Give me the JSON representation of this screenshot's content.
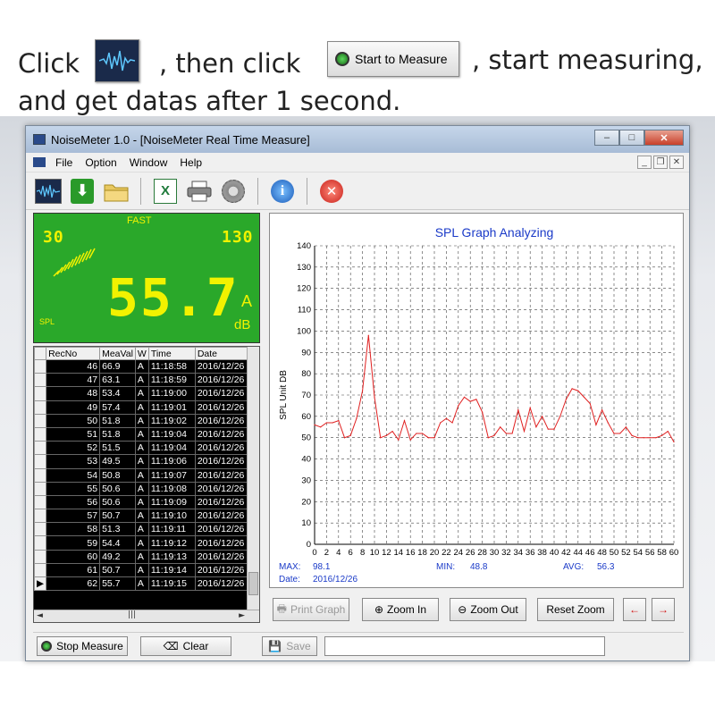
{
  "instructions": {
    "line1_a": "Click",
    "line1_b": ", then click",
    "line1_c": ", start measuring,",
    "line2": "and get datas after 1 second.",
    "button_label": "Start to Measure"
  },
  "window": {
    "title": "NoiseMeter 1.0  - [NoiseMeter Real Time Measure]",
    "controls": [
      "minimize",
      "maximize",
      "close"
    ]
  },
  "menu": {
    "items": [
      "File",
      "Option",
      "Window",
      "Help"
    ]
  },
  "toolbar": {
    "icons": [
      "realtime-measure-icon",
      "download-icon",
      "open-folder-icon",
      "excel-export-icon",
      "print-icon",
      "settings-icon",
      "info-icon",
      "exit-icon"
    ]
  },
  "lcd": {
    "mode": "FAST",
    "range_low": "30",
    "range_high": "130",
    "value": "55.7",
    "weighting": "A",
    "unit": "dB",
    "label": "SPL",
    "bg_color": "#2aa82a",
    "fg_color": "#f2f200"
  },
  "table": {
    "headers": [
      "RecNo",
      "MeaVal",
      "W",
      "Time",
      "Date"
    ],
    "rows": [
      [
        "46",
        "66.9",
        "A",
        "11:18:58",
        "2016/12/26"
      ],
      [
        "47",
        "63.1",
        "A",
        "11:18:59",
        "2016/12/26"
      ],
      [
        "48",
        "53.4",
        "A",
        "11:19:00",
        "2016/12/26"
      ],
      [
        "49",
        "57.4",
        "A",
        "11:19:01",
        "2016/12/26"
      ],
      [
        "50",
        "51.8",
        "A",
        "11:19:02",
        "2016/12/26"
      ],
      [
        "51",
        "51.8",
        "A",
        "11:19:04",
        "2016/12/26"
      ],
      [
        "52",
        "51.5",
        "A",
        "11:19:04",
        "2016/12/26"
      ],
      [
        "53",
        "49.5",
        "A",
        "11:19:06",
        "2016/12/26"
      ],
      [
        "54",
        "50.8",
        "A",
        "11:19:07",
        "2016/12/26"
      ],
      [
        "55",
        "50.6",
        "A",
        "11:19:08",
        "2016/12/26"
      ],
      [
        "56",
        "50.6",
        "A",
        "11:19:09",
        "2016/12/26"
      ],
      [
        "57",
        "50.7",
        "A",
        "11:19:10",
        "2016/12/26"
      ],
      [
        "58",
        "51.3",
        "A",
        "11:19:11",
        "2016/12/26"
      ],
      [
        "59",
        "54.4",
        "A",
        "11:19:12",
        "2016/12/26"
      ],
      [
        "60",
        "49.2",
        "A",
        "11:19:13",
        "2016/12/26"
      ],
      [
        "61",
        "50.7",
        "A",
        "11:19:14",
        "2016/12/26"
      ],
      [
        "62",
        "55.7",
        "A",
        "11:19:15",
        "2016/12/26"
      ]
    ],
    "current_row_index": 16
  },
  "graph": {
    "title": "SPL Graph Analyzing",
    "ylabel": "SPL  Unit  DB",
    "stats": {
      "max_label": "MAX:",
      "max_value": "98.1",
      "min_label": "MIN:",
      "min_value": "48.8",
      "avg_label": "AVG:",
      "avg_value": "56.3",
      "date_label": "Date:",
      "date_value": "2016/12/26"
    },
    "buttons": {
      "print": "Print Graph",
      "zoom_in": "Zoom In",
      "zoom_out": "Zoom Out",
      "reset": "Reset Zoom"
    }
  },
  "bottom": {
    "stop": "Stop Measure",
    "clear": "Clear",
    "save": "Save",
    "status_text": ""
  },
  "chart_data": {
    "type": "line",
    "title": "SPL Graph Analyzing",
    "xlabel": "",
    "ylabel": "SPL  Unit  DB",
    "xlim": [
      0,
      60
    ],
    "ylim": [
      0,
      140
    ],
    "x_ticks": [
      0,
      2,
      4,
      6,
      8,
      10,
      12,
      14,
      16,
      18,
      20,
      22,
      24,
      26,
      28,
      30,
      32,
      34,
      36,
      38,
      40,
      42,
      44,
      46,
      48,
      50,
      52,
      54,
      56,
      58,
      60
    ],
    "y_ticks": [
      0,
      10,
      20,
      30,
      40,
      50,
      60,
      70,
      80,
      90,
      100,
      110,
      120,
      130,
      140
    ],
    "grid": true,
    "line_color": "#e02020",
    "series": [
      {
        "x": [
          0,
          1,
          2,
          3,
          4,
          5,
          6,
          7,
          8,
          9,
          10,
          11,
          12,
          13,
          14,
          15,
          16,
          17,
          18,
          19,
          20,
          21,
          22,
          23,
          24,
          25,
          26,
          27,
          28,
          29,
          30,
          31,
          32,
          33,
          34,
          35,
          36,
          37,
          38,
          39,
          40,
          41,
          42,
          43,
          44,
          45,
          46,
          47,
          48,
          49,
          50,
          51,
          52,
          53,
          54,
          55,
          56,
          57,
          58,
          59,
          60
        ],
        "values": [
          56,
          55,
          57,
          57,
          58,
          50,
          51,
          59,
          72,
          98,
          69,
          50,
          51,
          53,
          49,
          58,
          49,
          52,
          52,
          50,
          50,
          57,
          59,
          57,
          65,
          69,
          67,
          68,
          62,
          50,
          51,
          55,
          52,
          52,
          63,
          53,
          64,
          55,
          60,
          54,
          54,
          60,
          68,
          73,
          72,
          69,
          66,
          56,
          63,
          57,
          52,
          52,
          55,
          51,
          50,
          50,
          50,
          50,
          51,
          53,
          48
        ]
      }
    ]
  }
}
